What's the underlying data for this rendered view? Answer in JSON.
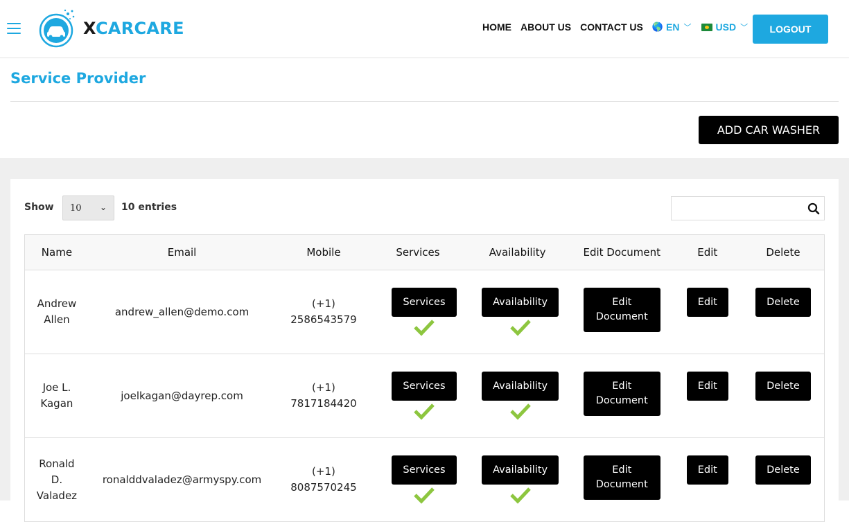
{
  "brand": {
    "prefix": "X",
    "name": "CARCARE"
  },
  "nav": {
    "home": "HOME",
    "about": "ABOUT US",
    "contact": "CONTACT US",
    "language": "EN",
    "currency": "USD",
    "logout": "LOGOUT"
  },
  "page": {
    "title": "Service Provider",
    "add_button": "ADD CAR WASHER"
  },
  "table_controls": {
    "show_label": "Show",
    "page_size": "10",
    "entries_label": "10 entries",
    "search_value": ""
  },
  "columns": [
    "Name",
    "Email",
    "Mobile",
    "Services",
    "Availability",
    "Edit Document",
    "Edit",
    "Delete"
  ],
  "rows": [
    {
      "name": "Andrew Allen",
      "email": "andrew_allen@demo.com",
      "mobile": "(+1) 2586543579",
      "services_label": "Services",
      "availability_label": "Availability",
      "edit_doc_label": "Edit Document",
      "edit_label": "Edit",
      "delete_label": "Delete"
    },
    {
      "name": "Joe L. Kagan",
      "email": "joelkagan@dayrep.com",
      "mobile": "(+1) 7817184420",
      "services_label": "Services",
      "availability_label": "Availability",
      "edit_doc_label": "Edit Document",
      "edit_label": "Edit",
      "delete_label": "Delete"
    },
    {
      "name": "Ronald D. Valadez",
      "email": "ronalddvaladez@armyspy.com",
      "mobile": "(+1) 8087570245",
      "services_label": "Services",
      "availability_label": "Availability",
      "edit_doc_label": "Edit Document",
      "edit_label": "Edit",
      "delete_label": "Delete"
    }
  ],
  "colors": {
    "accent": "#1ea8e0",
    "check": "#8dc63f",
    "button": "#000000"
  },
  "icons": {
    "menu": "hamburger-icon",
    "language": "globe-icon",
    "currency": "flag-icon",
    "search": "search-icon",
    "status": "check-icon"
  }
}
